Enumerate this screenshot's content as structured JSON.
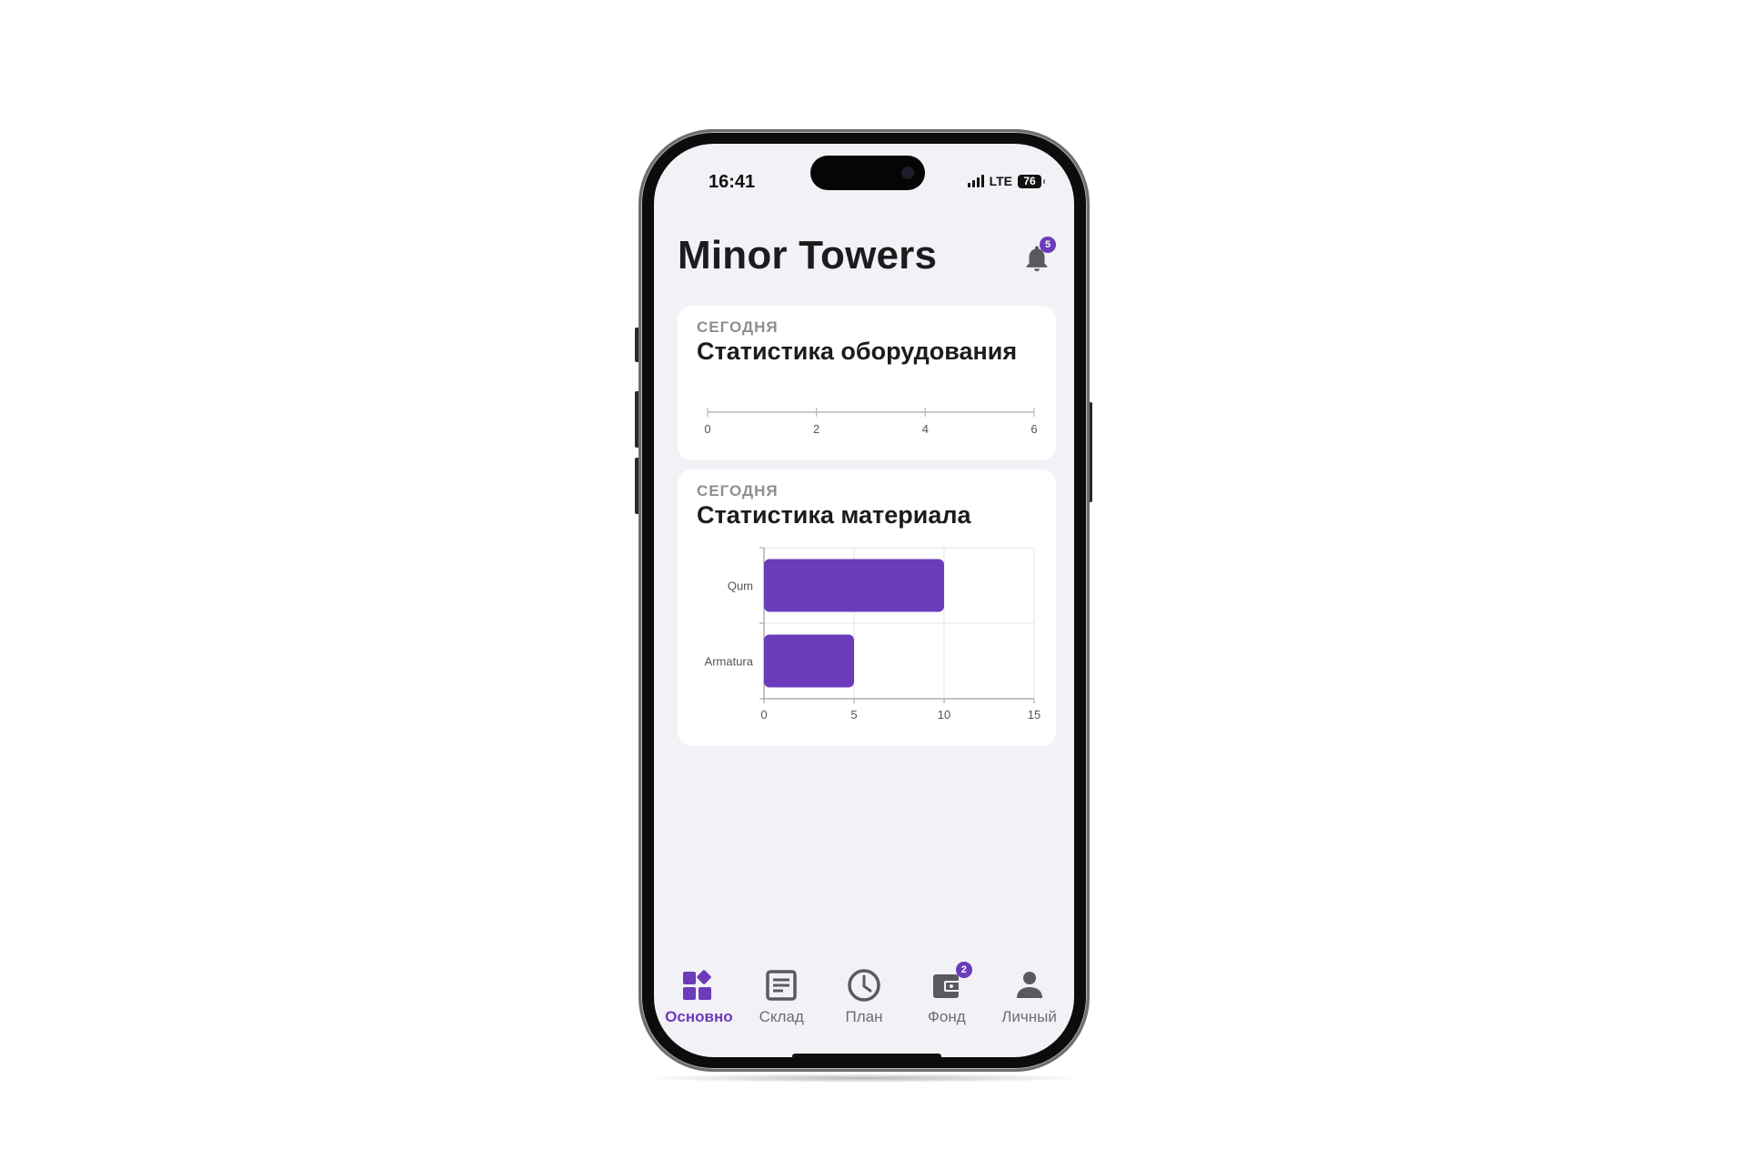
{
  "status": {
    "time": "16:41",
    "network": "LTE",
    "battery": "76"
  },
  "header": {
    "title": "Minor Towers",
    "notifications_count": "5"
  },
  "cards": [
    {
      "kicker": "СЕГОДНЯ",
      "title": "Статистика оборудования"
    },
    {
      "kicker": "СЕГОДНЯ",
      "title": "Статистика материала"
    }
  ],
  "chart_data": [
    {
      "type": "bar",
      "orientation": "horizontal",
      "categories": [],
      "values": [],
      "xlim": [
        0,
        6
      ],
      "xticks": [
        "0",
        "2",
        "4",
        "6"
      ]
    },
    {
      "type": "bar",
      "orientation": "horizontal",
      "categories": [
        "Qum",
        "Armatura"
      ],
      "values": [
        10,
        5
      ],
      "xlim": [
        0,
        15
      ],
      "xticks": [
        "0",
        "5",
        "10",
        "15"
      ],
      "grid": true,
      "bar_color": "#6a3bba"
    }
  ],
  "tabs": [
    {
      "id": "home",
      "label": "Основно",
      "icon": "dashboard-icon",
      "active": true,
      "badge": ""
    },
    {
      "id": "warehouse",
      "label": "Склад",
      "icon": "document-list-icon",
      "active": false,
      "badge": ""
    },
    {
      "id": "plan",
      "label": "План",
      "icon": "clock-icon",
      "active": false,
      "badge": ""
    },
    {
      "id": "fund",
      "label": "Фонд",
      "icon": "wallet-icon",
      "active": false,
      "badge": "2"
    },
    {
      "id": "personal",
      "label": "Личный",
      "icon": "person-icon",
      "active": false,
      "badge": ""
    }
  ],
  "colors": {
    "accent": "#6b3bbb",
    "background": "#f2f1f6",
    "card": "#ffffff",
    "inactive": "#6d6d72"
  }
}
